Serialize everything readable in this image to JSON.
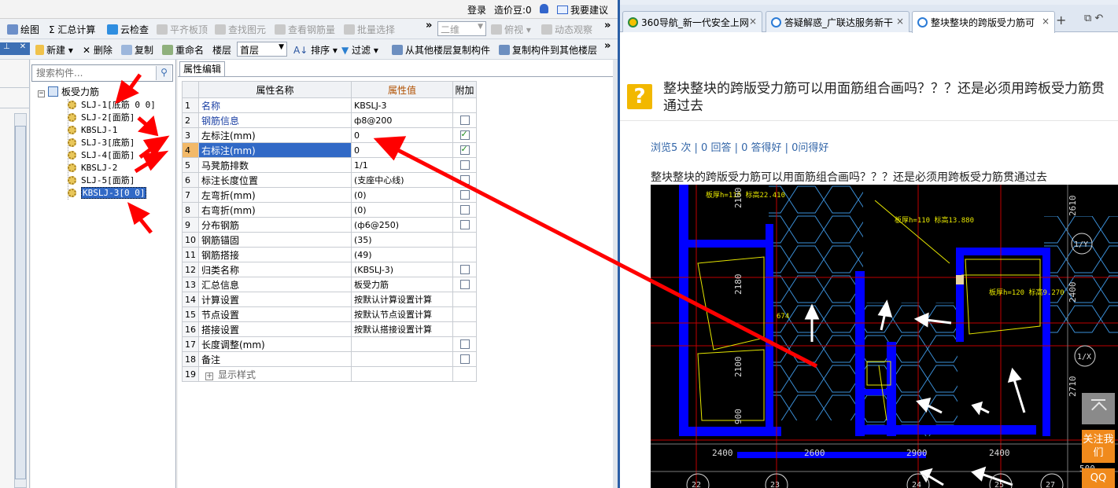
{
  "topbar": {
    "login": "登录",
    "beans": "造价豆:0",
    "suggest": "我要建议"
  },
  "toolbar1": {
    "draw": "绘图",
    "sum_calc": "汇总计算",
    "cloud_check": "云检查",
    "level_slab": "平齐板顶",
    "find_elem": "查找图元",
    "view_rebar": "查看钢筋量",
    "batch_select": "批量选择",
    "view_mode": "二维",
    "top_view": "俯视",
    "dyn_view": "动态观察"
  },
  "toolbar2": {
    "new": "新建",
    "delete": "删除",
    "copy": "复制",
    "rename": "重命名",
    "floor_label": "楼层",
    "floor_value": "首层",
    "sort": "排序",
    "filter": "过滤",
    "copy_from": "从其他楼层复制构件",
    "copy_to": "复制构件到其他楼层"
  },
  "tree": {
    "search_placeholder": "搜索构件...",
    "root": "板受力筋",
    "items": [
      {
        "label": "SLJ-1[底筋 0 0]"
      },
      {
        "label": "SLJ-2[面筋]"
      },
      {
        "label": "KBSLJ-1"
      },
      {
        "label": "SLJ-3[底筋]"
      },
      {
        "label": "SLJ-4[面筋]"
      },
      {
        "label": "KBSLJ-2"
      },
      {
        "label": "SLJ-5[面筋]"
      },
      {
        "label": "KBSLJ-3[0 0]"
      }
    ]
  },
  "props": {
    "tab": "属性编辑",
    "headers": {
      "name": "属性名称",
      "value": "属性值",
      "extra": "附加"
    },
    "rows": [
      {
        "n": "1",
        "name": "名称",
        "value": "KBSLJ-3",
        "cb": "none"
      },
      {
        "n": "2",
        "name": "钢筋信息",
        "value": "ф8@200",
        "cb": "off"
      },
      {
        "n": "3",
        "name": "左标注(mm)",
        "value": "0",
        "cb": "on"
      },
      {
        "n": "4",
        "name": "右标注(mm)",
        "value": "0",
        "cb": "on"
      },
      {
        "n": "5",
        "name": "马凳筋排数",
        "value": "1/1",
        "cb": "off"
      },
      {
        "n": "6",
        "name": "标注长度位置",
        "value": "(支座中心线)",
        "cb": "off"
      },
      {
        "n": "7",
        "name": "左弯折(mm)",
        "value": "(0)",
        "cb": "off"
      },
      {
        "n": "8",
        "name": "右弯折(mm)",
        "value": "(0)",
        "cb": "off"
      },
      {
        "n": "9",
        "name": "分布钢筋",
        "value": "(ф6@250)",
        "cb": "off"
      },
      {
        "n": "10",
        "name": "钢筋锚固",
        "value": "(35)",
        "cb": "none"
      },
      {
        "n": "11",
        "name": "钢筋搭接",
        "value": "(49)",
        "cb": "none"
      },
      {
        "n": "12",
        "name": "归类名称",
        "value": "(KBSLJ-3)",
        "cb": "off"
      },
      {
        "n": "13",
        "name": "汇总信息",
        "value": "板受力筋",
        "cb": "off"
      },
      {
        "n": "14",
        "name": "计算设置",
        "value": "按默认计算设置计算",
        "cb": "none"
      },
      {
        "n": "15",
        "name": "节点设置",
        "value": "按默认节点设置计算",
        "cb": "none"
      },
      {
        "n": "16",
        "name": "搭接设置",
        "value": "按默认搭接设置计算",
        "cb": "none"
      },
      {
        "n": "17",
        "name": "长度调整(mm)",
        "value": "",
        "cb": "off"
      },
      {
        "n": "18",
        "name": "备注",
        "value": "",
        "cb": "off"
      },
      {
        "n": "19",
        "name": "显示样式",
        "value": "",
        "cb": "none"
      }
    ]
  },
  "browser": {
    "tabs": [
      {
        "label": "360导航_新一代安全上网"
      },
      {
        "label": "答疑解惑_广联达服务新干"
      },
      {
        "label": "整块整块的跨版受力筋可"
      }
    ],
    "question_title": "整块整块的跨版受力筋可以用面筋组合画吗？？？还是必须用跨板受力筋贯通过去",
    "stats": "浏览5 次 | 0 回答 | 0 答得好 | 0问得好",
    "body": "整块整块的跨版受力筋可以用面筋组合画吗？？？还是必须用跨板受力筋贯通过去",
    "follow": "关注我们",
    "qq": "QQ"
  },
  "cad": {
    "dims_bottom": [
      "2400",
      "2600",
      "2900",
      "2400",
      "500"
    ],
    "axis_labels": [
      "22",
      "23",
      "24",
      "25",
      "27"
    ],
    "side_labels": [
      "1/Y",
      "1/X"
    ],
    "room_tags": [
      "2100",
      "2180",
      "2100",
      "900",
      "2610",
      "2400",
      "2710",
      "674"
    ],
    "slab_notes": [
      "板厚h=110 标高22.410",
      "板厚h=110 标高13.880",
      "板厚h=120 标高9.270"
    ]
  },
  "colors": {
    "arrow": "#ff0000",
    "accent": "#3169c6",
    "cad_blue": "#0000ff"
  }
}
